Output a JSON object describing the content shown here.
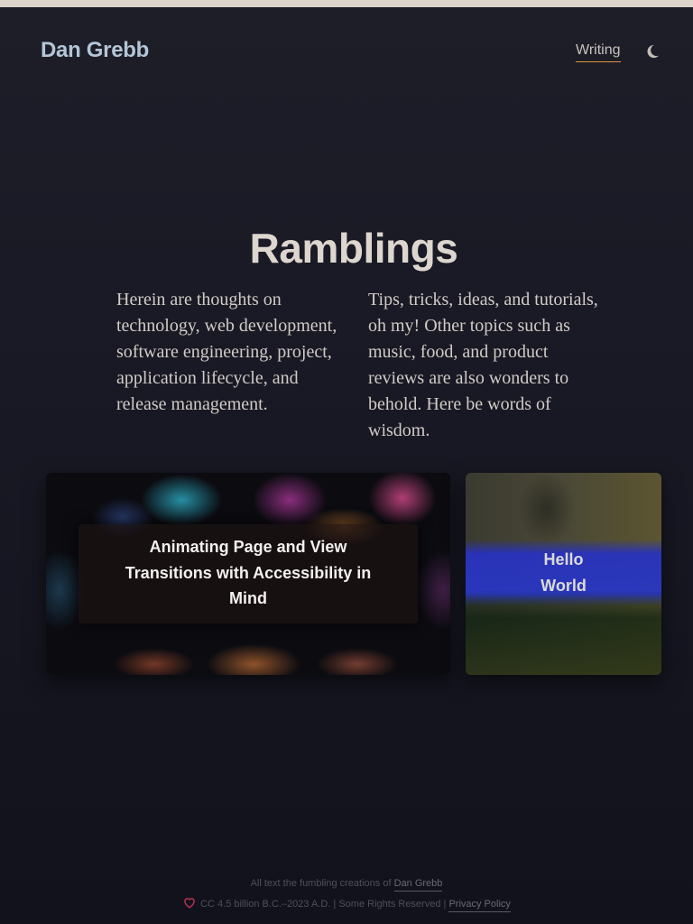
{
  "header": {
    "site_title": "Dan Grebb",
    "nav": [
      {
        "label": "Writing",
        "active": true
      }
    ],
    "theme_toggle_icon": "moon-icon"
  },
  "main": {
    "title": "Ramblings",
    "intro_left": "Herein are thoughts on technology, web development, software engineering, project, application lifecycle, and release management.",
    "intro_right": "Tips, tricks, ideas, and tutorials, oh my! Other topics such as music, food, and product reviews are also wonders to behold. Here be words of wisdom.",
    "posts": [
      {
        "title": "Animating Page and View Transitions with Accessibility in Mind"
      },
      {
        "title": "Hello World"
      }
    ]
  },
  "footer": {
    "line1_prefix": "All text the fumbling creations of",
    "author_link": "Dan Grebb",
    "heart_icon": "heart-icon",
    "license_text": "CC 4.5 billion B.C.–2023 A.D. | Some Rights Reserved |",
    "privacy_link": "Privacy Policy"
  },
  "colors": {
    "accent": "#e1933f",
    "site_title": "#b3c6d7",
    "background": "#1b1b26",
    "heart": "#c0334d"
  }
}
